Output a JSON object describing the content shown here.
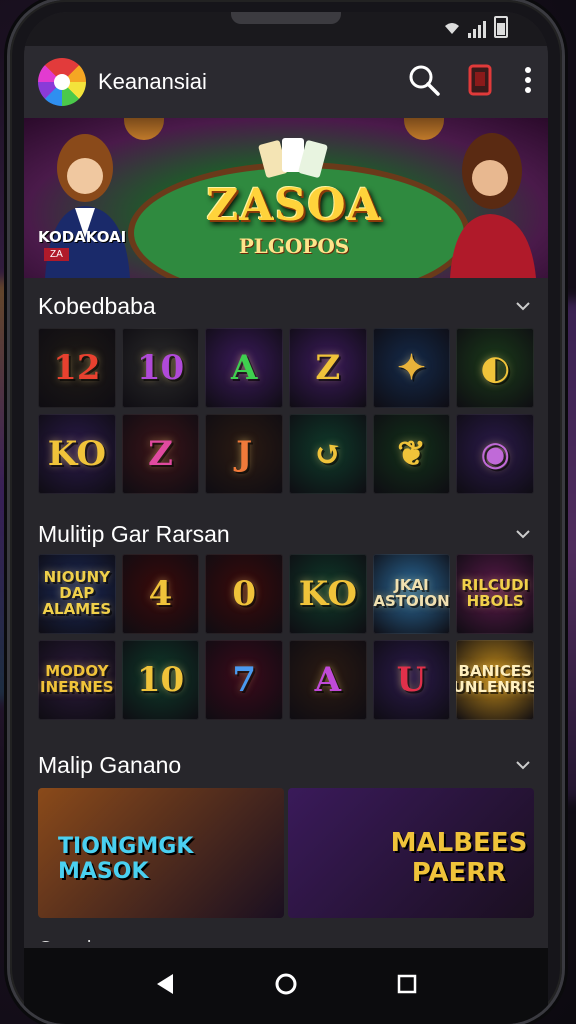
{
  "app": {
    "title": "Keanansiai"
  },
  "banner": {
    "title": "ZASOA",
    "subtitle": "PLGOPOS",
    "left_badge": "KODAKOAI",
    "left_badge_sub": "ZA"
  },
  "sections": [
    {
      "title": "Kobedbaba",
      "tiles": [
        {
          "label": "12",
          "bg": "#1e1a16",
          "fg": "#e8412f"
        },
        {
          "label": "10",
          "bg": "#2a2a2a",
          "fg": "#b04ad8"
        },
        {
          "label": "A",
          "bg": "#3a1a5a",
          "fg": "#3fcf4f"
        },
        {
          "label": "Z",
          "bg": "#3a1a5a",
          "fg": "#f0c33a"
        },
        {
          "label": "✦",
          "bg": "#142a4a",
          "fg": "#e8b23a"
        },
        {
          "label": "◐",
          "bg": "#1a3a1a",
          "fg": "#f0c33a"
        },
        {
          "label": "KO",
          "bg": "#2a1a4a",
          "fg": "#f0c33a"
        },
        {
          "label": "Z",
          "bg": "#3a1418",
          "fg": "#e04aa0"
        },
        {
          "label": "J",
          "bg": "#2a1a12",
          "fg": "#f07a3a"
        },
        {
          "label": "↺",
          "bg": "#0f3a2a",
          "fg": "#f0c33a"
        },
        {
          "label": "❦",
          "bg": "#12301a",
          "fg": "#f0c33a"
        },
        {
          "label": "◉",
          "bg": "#2a1a4a",
          "fg": "#c06ad8"
        }
      ]
    },
    {
      "title": "Mulitip Gar Rarsan",
      "tiles": [
        {
          "label": "NIOUNY DAP ALAMES",
          "bg": "#1a2a5a",
          "fg": "#f0d04a",
          "small": true
        },
        {
          "label": "4",
          "bg": "#3a0a0a",
          "fg": "#f0c33a"
        },
        {
          "label": "0",
          "bg": "#3a0a0a",
          "fg": "#f0c33a"
        },
        {
          "label": "KO",
          "bg": "#0f3a2a",
          "fg": "#f0c33a"
        },
        {
          "label": "JKAI ASTOION",
          "bg": "#2a6a9a",
          "fg": "#f0e0b0",
          "small": true
        },
        {
          "label": "RILCUDI HBOLS",
          "bg": "#5a1a4a",
          "fg": "#f0d04a",
          "small": true
        },
        {
          "label": "MODOY INERNES",
          "bg": "#2a1a3a",
          "fg": "#f0c33a",
          "small": true
        },
        {
          "label": "10",
          "bg": "#0f3a2a",
          "fg": "#f0c33a"
        },
        {
          "label": "7",
          "bg": "#3a0a1a",
          "fg": "#4a9af0"
        },
        {
          "label": "A",
          "bg": "#2a1a12",
          "fg": "#c04ad8"
        },
        {
          "label": "U",
          "bg": "#2a1a4a",
          "fg": "#e0304a"
        },
        {
          "label": "BANICES UNLENRIS",
          "bg": "#c08a1a",
          "fg": "#fff0c0",
          "small": true
        }
      ]
    },
    {
      "title": "Malip Ganano",
      "promos": [
        {
          "label": "TIONGMGK MASOK",
          "bg": "#8a4a1a",
          "fg": "#4ad0f0"
        },
        {
          "label": "MALBEES PAERR",
          "bg": "#3a1a5a",
          "fg": "#f0c33a"
        }
      ]
    }
  ],
  "next_section_peek": "Oanahawa",
  "icons": {
    "search": "search-icon",
    "cast": "screen-cast-icon",
    "more": "more-vert-icon",
    "back": "back-icon",
    "home": "home-icon",
    "recents": "recents-icon"
  }
}
